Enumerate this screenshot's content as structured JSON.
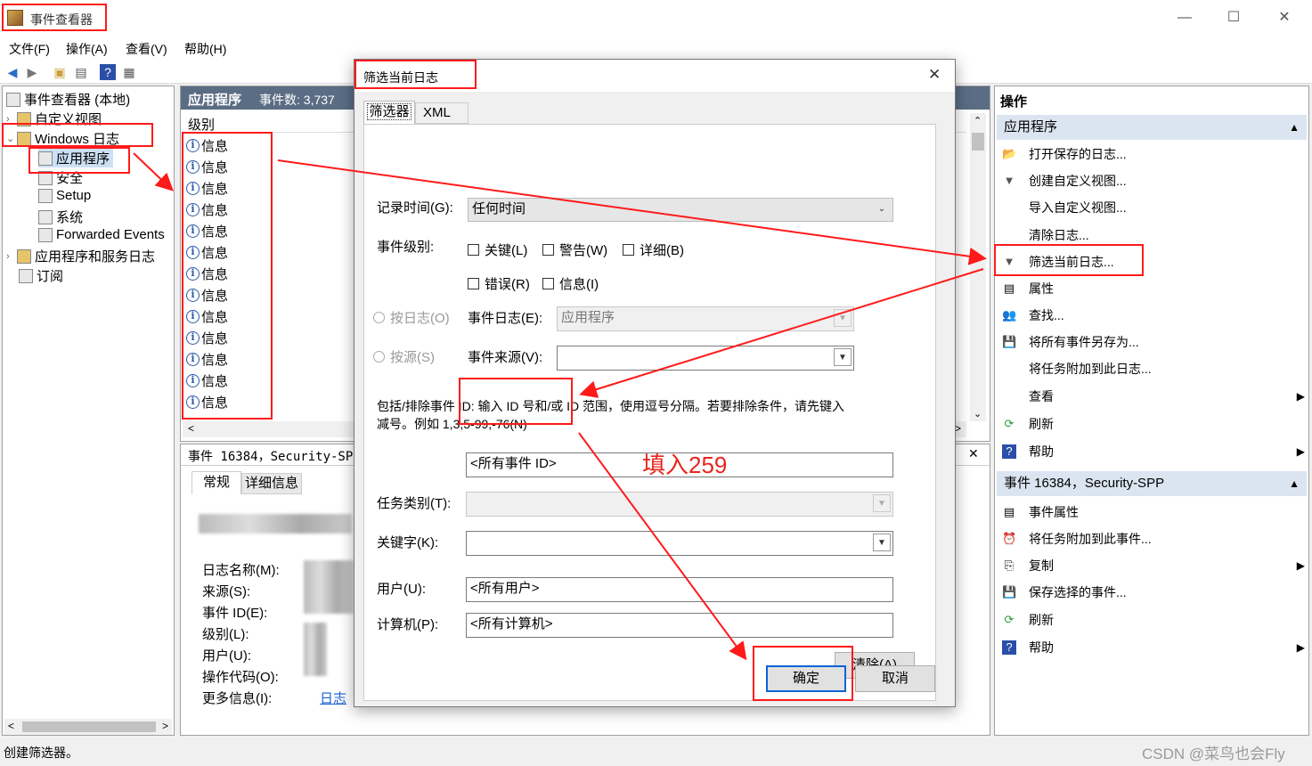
{
  "window": {
    "title": "事件查看器"
  },
  "menu": [
    "文件(F)",
    "操作(A)",
    "查看(V)",
    "帮助(H)"
  ],
  "tree": {
    "root": "事件查看器 (本地)",
    "custom_views": "自定义视图",
    "windows_logs": "Windows 日志",
    "application": "应用程序",
    "security": "安全",
    "setup": "Setup",
    "system": "系统",
    "forwarded": "Forwarded Events",
    "app_service_logs": "应用程序和服务日志",
    "subscriptions": "订阅"
  },
  "event_list": {
    "header_title": "应用程序",
    "header_count": "事件数: 3,737",
    "column_level": "级别",
    "rows": [
      "信息",
      "信息",
      "信息",
      "信息",
      "信息",
      "信息",
      "信息",
      "信息",
      "信息",
      "信息",
      "信息",
      "信息",
      "信息"
    ]
  },
  "detail": {
    "title": "事件 16384，Security-SPP",
    "tab_general": "常规",
    "tab_details": "详细信息",
    "fields": [
      "日志名称(M):",
      "来源(S):",
      "事件 ID(E):",
      "级别(L):",
      "用户(U):",
      "操作代码(O):",
      "更多信息(I):"
    ],
    "more_info_link": "日志"
  },
  "dialog": {
    "title": "筛选当前日志",
    "tab_filter": "筛选器",
    "tab_xml": "XML",
    "logged_label": "记录时间(G):",
    "logged_value": "任何时间",
    "level_label": "事件级别:",
    "levels_row1": [
      "关键(L)",
      "警告(W)",
      "详细(B)"
    ],
    "levels_row2": [
      "错误(R)",
      "信息(I)"
    ],
    "by_log": "按日志(O)",
    "by_source": "按源(S)",
    "event_logs_label": "事件日志(E):",
    "event_logs_value": "应用程序",
    "event_sources_label": "事件来源(V):",
    "event_sources_value": "",
    "id_help_line1": "包括/排除事件 ID: 输入 ID 号和/或 ID 范围，使用逗号分隔。若要排除条件，请先键入",
    "id_help_line2": "减号。例如 1,3,5-99,-76(N)",
    "event_id_value": "<所有事件 ID>",
    "annotation": "填入259",
    "task_category_label": "任务类别(T):",
    "keywords_label": "关键字(K):",
    "user_label": "用户(U):",
    "user_value": "<所有用户>",
    "computer_label": "计算机(P):",
    "computer_value": "<所有计算机>",
    "clear_button": "清除(A)",
    "ok_button": "确定",
    "cancel_button": "取消"
  },
  "actions": {
    "header": "操作",
    "section1": "应用程序",
    "items1": [
      "打开保存的日志...",
      "创建自定义视图...",
      "导入自定义视图...",
      "清除日志...",
      "筛选当前日志...",
      "属性",
      "查找...",
      "将所有事件另存为...",
      "将任务附加到此日志...",
      "查看",
      "刷新",
      "帮助"
    ],
    "section2": "事件 16384，Security-SPP",
    "items2": [
      "事件属性",
      "将任务附加到此事件...",
      "复制",
      "保存选择的事件...",
      "刷新",
      "帮助"
    ]
  },
  "status_bar": {
    "text": "创建筛选器。"
  },
  "watermark": "CSDN @菜鸟也会Fly",
  "colors": {
    "highlight_red": "#ff1a1a",
    "annotation_red": "#e8261e",
    "section_blue": "#dbe5f1",
    "list_header": "#5b6d84"
  }
}
